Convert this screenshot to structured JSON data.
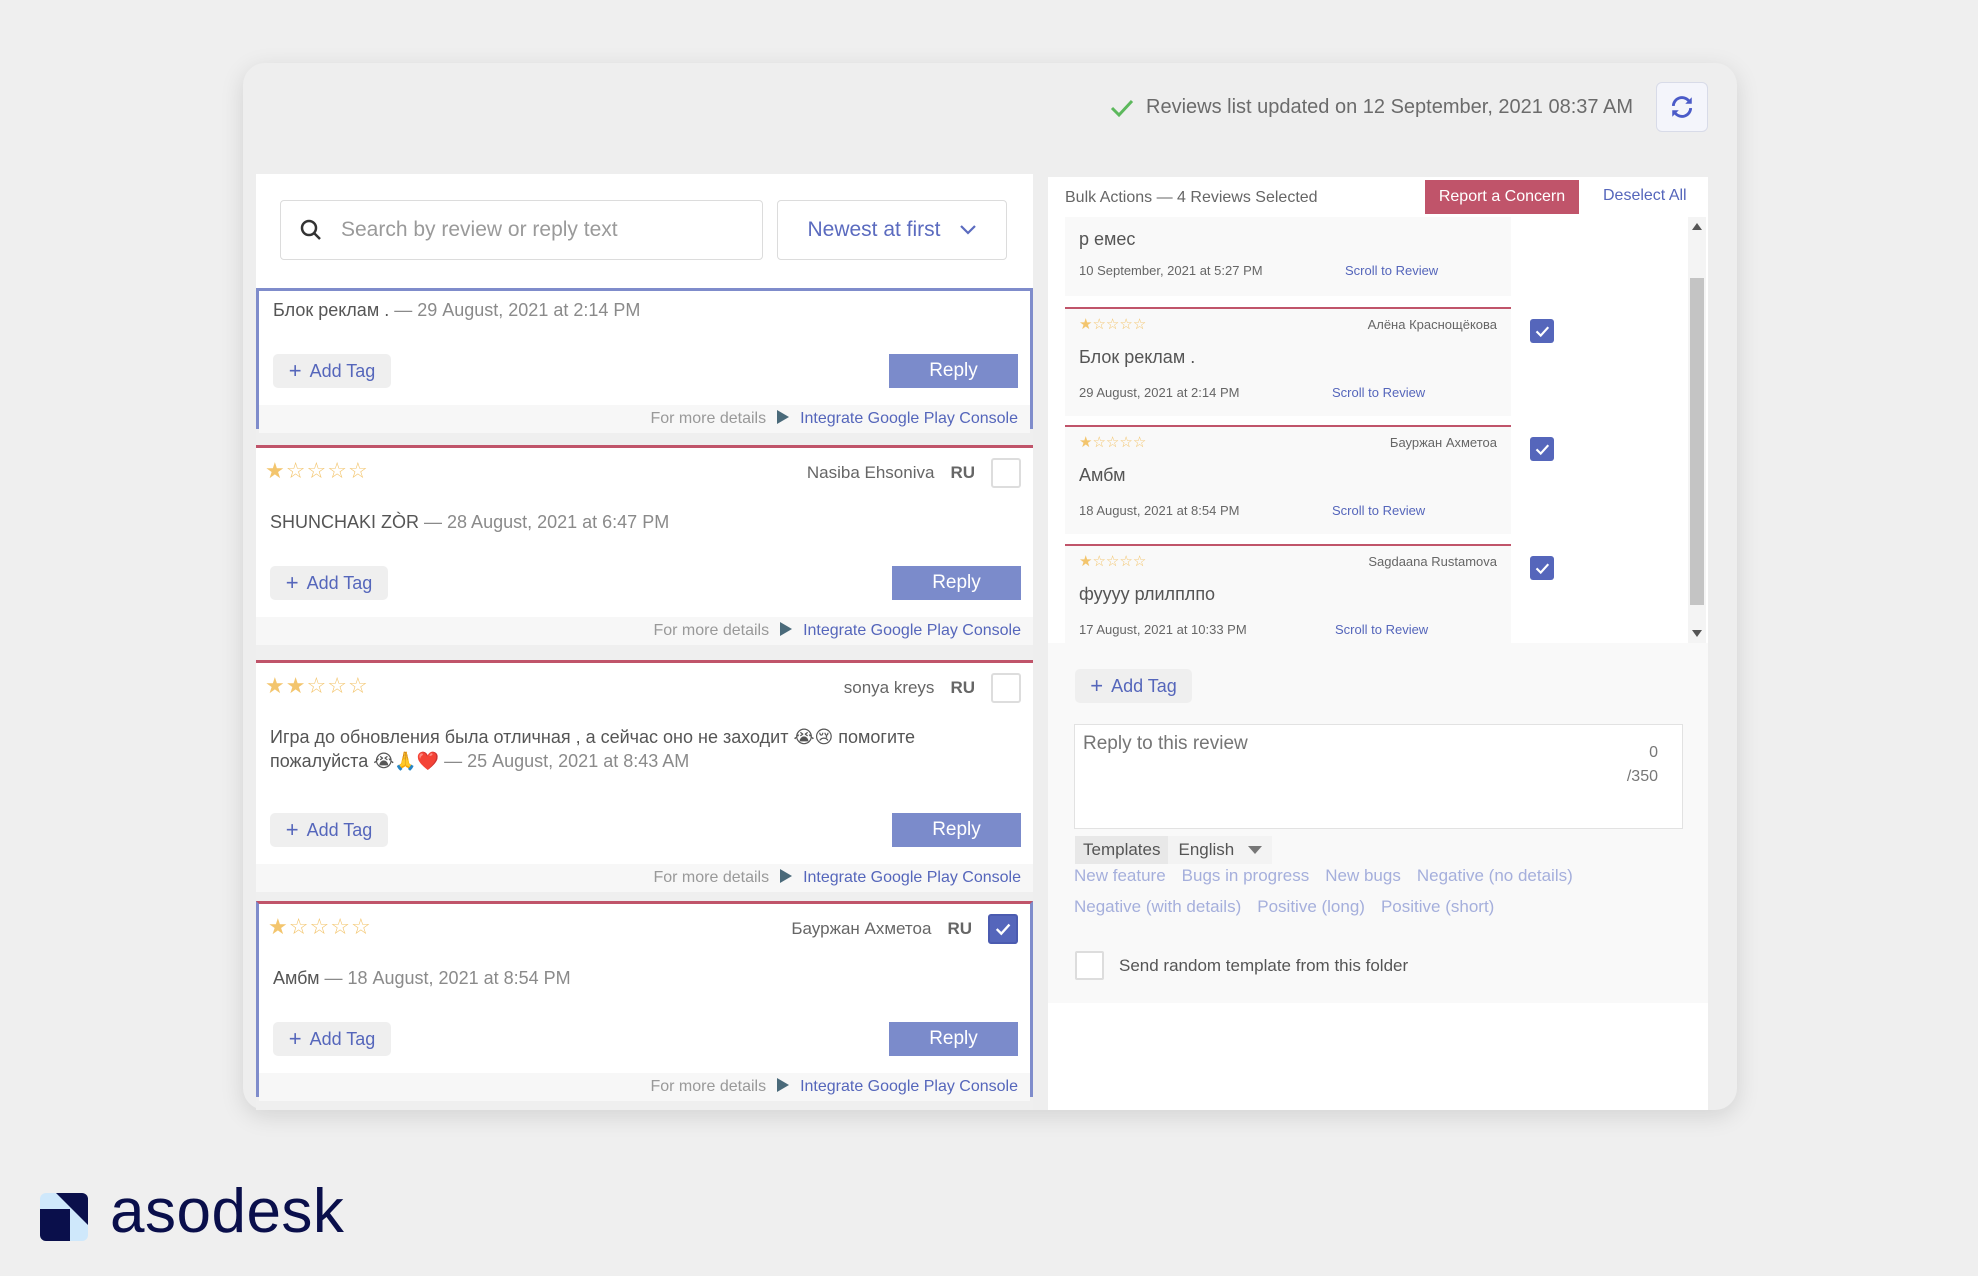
{
  "header": {
    "status_text": "Reviews list updated on 12 September, 2021 08:37 AM",
    "status_icon": "check-icon",
    "refresh_icon": "refresh-icon"
  },
  "search": {
    "placeholder": "Search by review or reply text",
    "sort_value": "Newest at first"
  },
  "reviews": [
    {
      "stars": null,
      "author": "",
      "lang": "",
      "checked": true,
      "text": "Блок реклам .",
      "date": "29 August, 2021 at 2:14 PM",
      "partial": true
    },
    {
      "stars": 1,
      "author": "Nasiba Ehsoniva",
      "lang": "RU",
      "checked": false,
      "text": "SHUNCHAKI ZÒR",
      "date": "28 August, 2021 at 6:47 PM"
    },
    {
      "stars": 2,
      "author": "sonya kreys",
      "lang": "RU",
      "checked": false,
      "text": "Игра до обновления была отличная , а сейчас оно не заходит 😭😢 помогите пожалуйста 😭🙏❤️",
      "date": "25 August, 2021 at 8:43 AM"
    },
    {
      "stars": 1,
      "author": "Бауржан Ахметоа",
      "lang": "RU",
      "checked": true,
      "text": "Амбм",
      "date": "18 August, 2021 at 8:54 PM"
    }
  ],
  "review_labels": {
    "add_tag": "Add Tag",
    "reply": "Reply",
    "more_details": "For more details",
    "integrate": "Integrate Google Play Console"
  },
  "bulk": {
    "title": "Bulk Actions — 4 Reviews Selected",
    "report": "Report a Concern",
    "deselect": "Deselect All",
    "scroll_label": "Scroll to Review",
    "items": [
      {
        "stars": null,
        "author": "",
        "text": "р емес",
        "date": "10 September, 2021 at 5:27 PM"
      },
      {
        "stars": 1,
        "author": "Алёна Краснощёкова",
        "text": "Блок реклам .",
        "date": "29 August, 2021 at 2:14 PM"
      },
      {
        "stars": 1,
        "author": "Бауржан Ахметоа",
        "text": "Амбм",
        "date": "18 August, 2021 at 8:54 PM"
      },
      {
        "stars": 1,
        "author": "Sagdaana Rustamova",
        "text": "фуууу рлилплпо",
        "date": "17 August, 2021 at 10:33 PM"
      }
    ],
    "add_tag": "Add Tag",
    "reply_placeholder": "Reply to this review",
    "char_count": "0",
    "char_max": "/350",
    "templates_label": "Templates",
    "language": "English",
    "template_links": [
      [
        "New feature",
        "Bugs in progress",
        "New bugs",
        "Negative (no details)"
      ],
      [
        "Negative (with details)",
        "Positive (long)",
        "Positive (short)"
      ]
    ],
    "random_label": "Send random template from this folder"
  },
  "brand": {
    "name": "asodesk"
  },
  "colors": {
    "accent": "#5566bb",
    "reply_button": "#7b8bcb",
    "concern": "#c0546a",
    "star": "#f3c56d",
    "brand": "#0a0f4b"
  }
}
